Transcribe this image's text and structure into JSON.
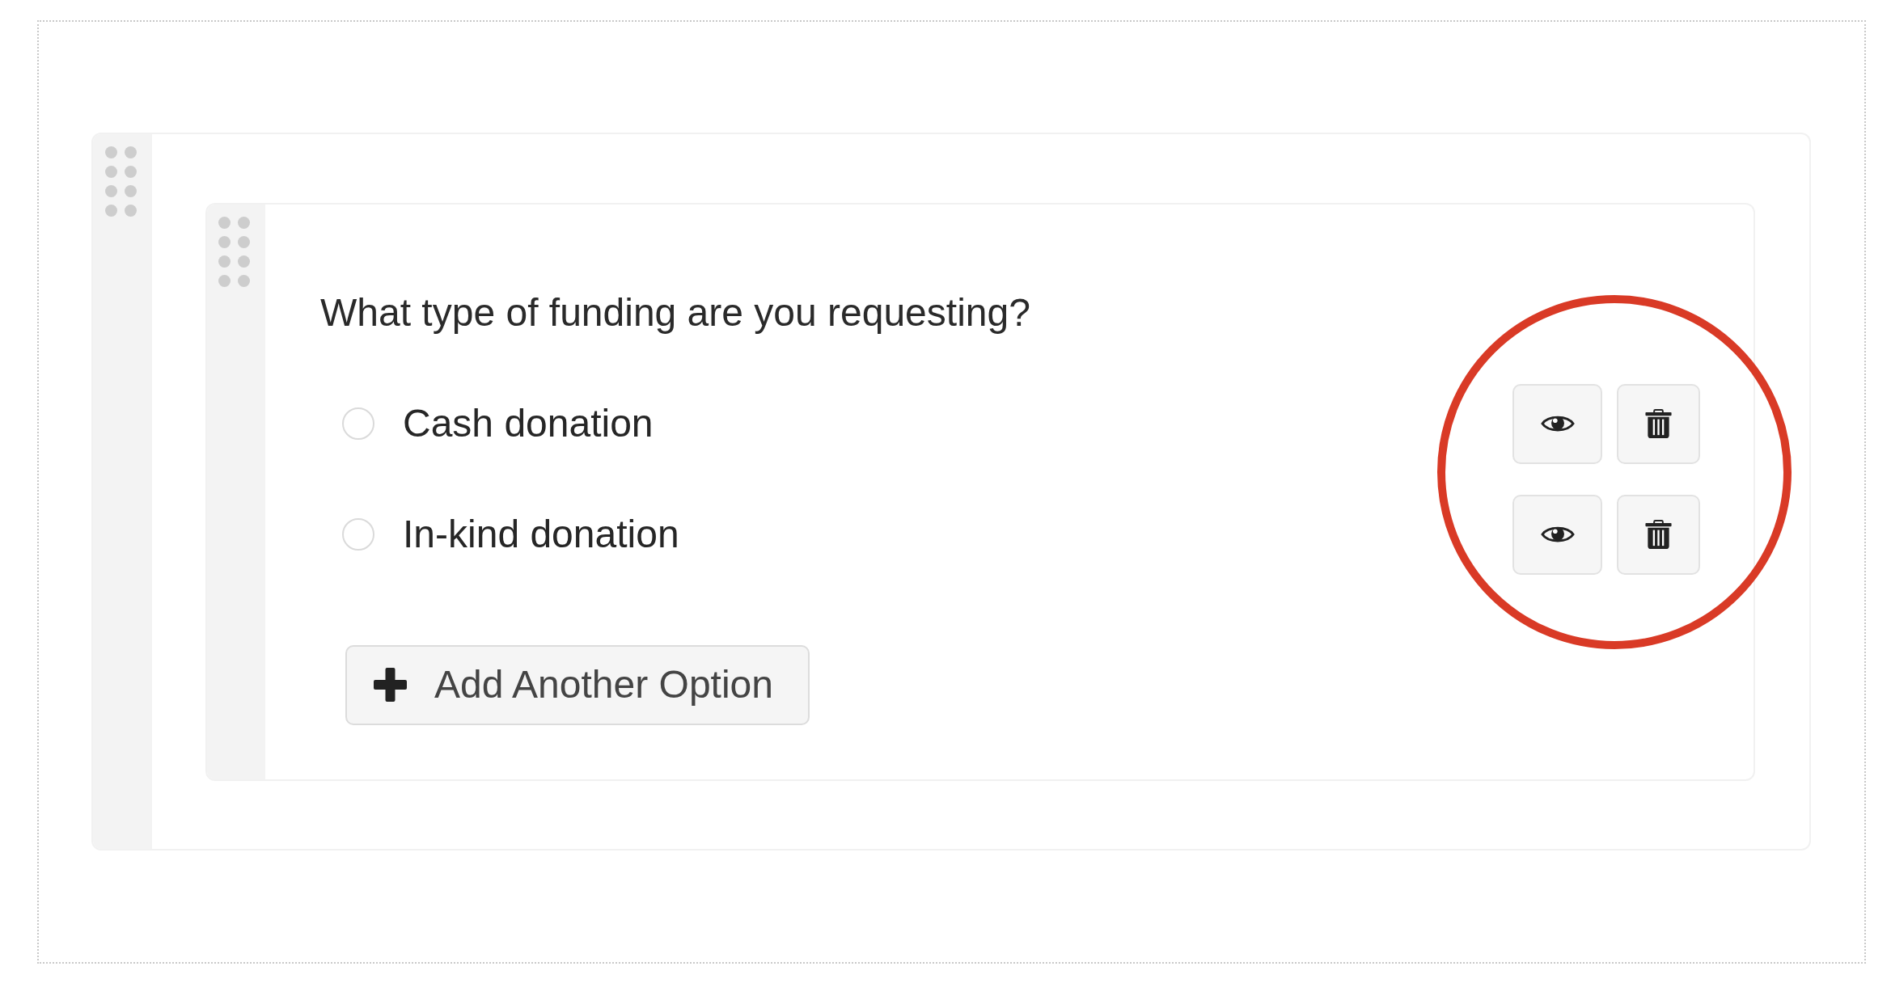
{
  "question": {
    "text": "What type of funding are you requesting?",
    "options": [
      {
        "label": "Cash donation",
        "selected": false
      },
      {
        "label": "In-kind donation",
        "selected": false
      }
    ],
    "add_option_button": "Add Another Option",
    "actions_circled": true
  }
}
